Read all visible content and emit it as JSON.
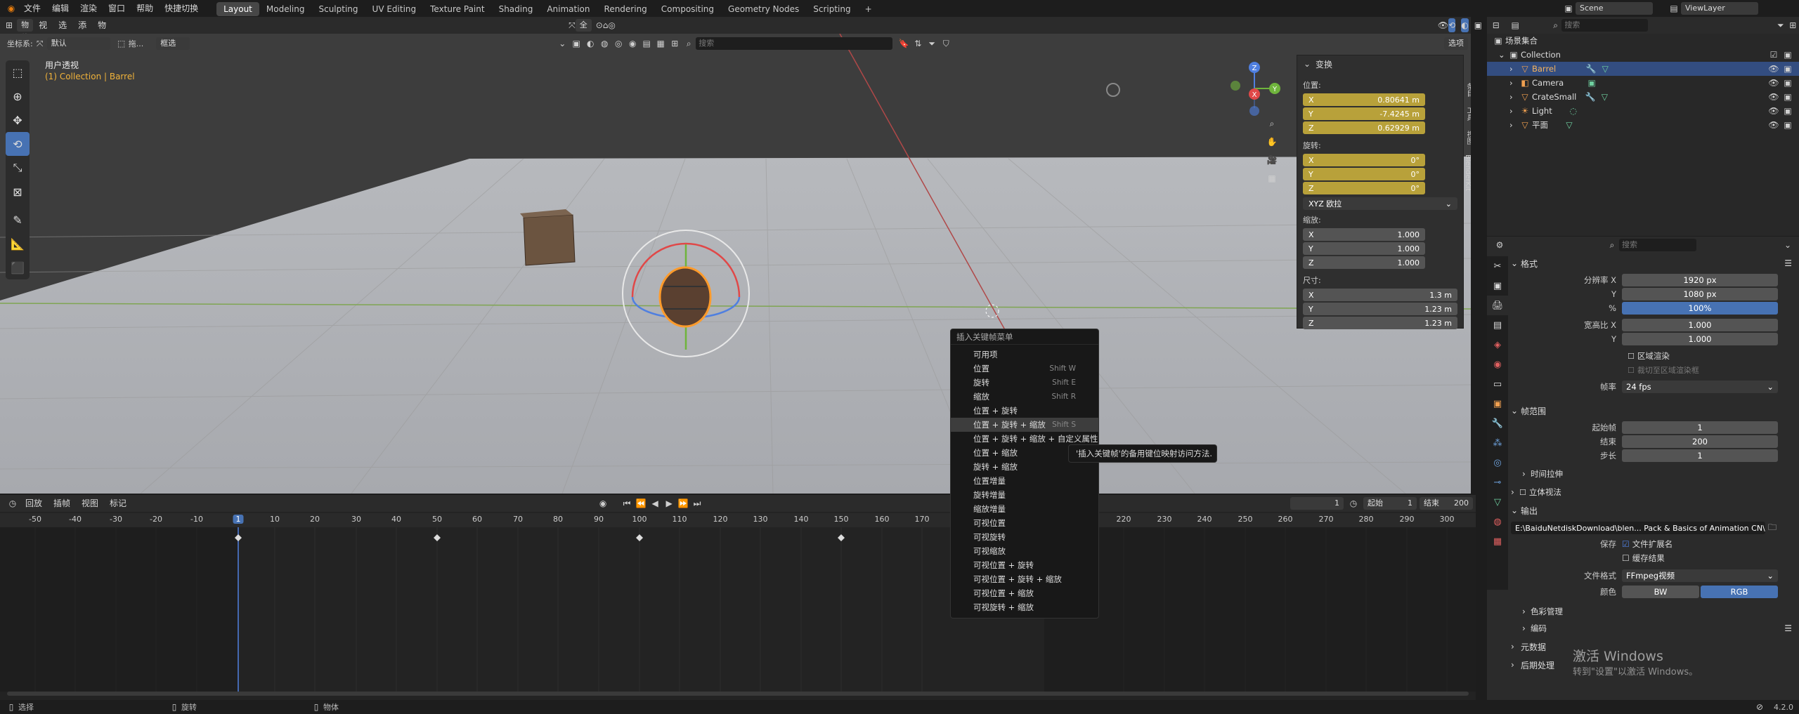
{
  "topbar": {
    "menus": [
      "文件",
      "编辑",
      "渲染",
      "窗口",
      "帮助",
      "快捷切换"
    ],
    "workspaces": [
      "Layout",
      "Modeling",
      "Sculpting",
      "UV Editing",
      "Texture Paint",
      "Shading",
      "Animation",
      "Rendering",
      "Compositing",
      "Geometry Nodes",
      "Scripting"
    ],
    "active_workspace": "Layout",
    "add_tab": "+",
    "scene": "Scene",
    "view_layer": "ViewLayer"
  },
  "viewport_header": {
    "mode": "物体模式",
    "menus": [
      "视图",
      "选择",
      "添加",
      "物体"
    ],
    "transform_orient": "全局",
    "coord_label": "坐标系:",
    "coord_value": "默认",
    "drag_label": "拖...",
    "select_mode": "框选",
    "search_placeholder": "搜索",
    "options": "选项"
  },
  "viewport": {
    "view_name": "用户透视",
    "collection_info": "(1) Collection | Barrel",
    "side_tabs": [
      "条目",
      "工具",
      "视图",
      "BlenderKit"
    ]
  },
  "transform_panel": {
    "title": "变换",
    "location_label": "位置:",
    "location": [
      {
        "axis": "X",
        "value": "0.80641 m"
      },
      {
        "axis": "Y",
        "value": "-7.4245 m"
      },
      {
        "axis": "Z",
        "value": "0.62929 m"
      }
    ],
    "rotation_label": "旋转:",
    "rotation": [
      {
        "axis": "X",
        "value": "0°"
      },
      {
        "axis": "Y",
        "value": "0°"
      },
      {
        "axis": "Z",
        "value": "0°"
      }
    ],
    "rotation_mode": "XYZ 欧拉",
    "scale_label": "缩放:",
    "scale": [
      {
        "axis": "X",
        "value": "1.000"
      },
      {
        "axis": "Y",
        "value": "1.000"
      },
      {
        "axis": "Z",
        "value": "1.000"
      }
    ],
    "dimensions_label": "尺寸:",
    "dimensions": [
      {
        "axis": "X",
        "value": "1.3 m"
      },
      {
        "axis": "Y",
        "value": "1.23 m"
      },
      {
        "axis": "Z",
        "value": "1.23 m"
      }
    ]
  },
  "context_menu": {
    "title": "插入关键帧菜单",
    "items": [
      {
        "label": "可用项",
        "shortcut": ""
      },
      {
        "label": "位置",
        "shortcut": "Shift W"
      },
      {
        "label": "旋转",
        "shortcut": "Shift E"
      },
      {
        "label": "缩放",
        "shortcut": "Shift R"
      },
      {
        "label": "位置 + 旋转",
        "shortcut": ""
      },
      {
        "label": "位置 + 旋转 + 缩放",
        "shortcut": "Shift S"
      },
      {
        "label": "位置 + 旋转 + 缩放 + 自定义属性",
        "shortcut": ""
      },
      {
        "label": "位置 + 缩放",
        "shortcut": ""
      },
      {
        "label": "旋转 + 缩放",
        "shortcut": ""
      },
      {
        "label": "位置增量",
        "shortcut": ""
      },
      {
        "label": "旋转增量",
        "shortcut": ""
      },
      {
        "label": "缩放增量",
        "shortcut": ""
      },
      {
        "label": "可视位置",
        "shortcut": ""
      },
      {
        "label": "可视旋转",
        "shortcut": ""
      },
      {
        "label": "可视缩放",
        "shortcut": ""
      },
      {
        "label": "可视位置 + 旋转",
        "shortcut": ""
      },
      {
        "label": "可视位置 + 旋转 + 缩放",
        "shortcut": ""
      },
      {
        "label": "可视位置 + 缩放",
        "shortcut": ""
      },
      {
        "label": "可视旋转 + 缩放",
        "shortcut": ""
      }
    ],
    "tooltip": "'插入关键帧'的备用键位映射访问方法."
  },
  "timeline": {
    "menus": [
      "回放",
      "插帧",
      "视图",
      "标记"
    ],
    "current_frame": "1",
    "start_label": "起始",
    "start": "1",
    "end_label": "结束",
    "end": "200",
    "ruler_left": [
      "-50",
      "-40",
      "-30",
      "-20",
      "-10",
      "1",
      "10",
      "20",
      "30",
      "40",
      "50",
      "60",
      "70",
      "80",
      "90",
      "100",
      "110",
      "120",
      "130",
      "140",
      "150",
      "160",
      "170"
    ],
    "ruler_right": [
      "220",
      "230",
      "240",
      "250",
      "260",
      "270",
      "280",
      "290",
      "300"
    ],
    "playhead": "1"
  },
  "status_bar": {
    "items": [
      "选择",
      "旋转",
      "物体"
    ],
    "version": "4.2.0"
  },
  "outliner": {
    "search_placeholder": "搜索",
    "root": "场景集合",
    "collection": "Collection",
    "objects": [
      {
        "name": "Barrel",
        "selected": true
      },
      {
        "name": "Camera",
        "selected": false
      },
      {
        "name": "CrateSmall",
        "selected": false
      },
      {
        "name": "Light",
        "selected": false
      },
      {
        "name": "平面",
        "selected": false
      }
    ]
  },
  "properties": {
    "search_placeholder": "搜索",
    "format_title": "格式",
    "res_x_label": "分辨率 X",
    "res_x": "1920 px",
    "res_y_label": "Y",
    "res_y": "1080 px",
    "pct_label": "%",
    "pct": "100%",
    "aspect_x_label": "宽高比 X",
    "aspect_x": "1.000",
    "aspect_y_label": "Y",
    "aspect_y": "1.000",
    "border_label": "区域渲染",
    "crop_label": "裁切至区域渲染框",
    "fps_label": "帧率",
    "fps": "24 fps",
    "frame_range_title": "帧范围",
    "frame_start_label": "起始帧",
    "frame_start": "1",
    "frame_end_label": "结束",
    "frame_end": "200",
    "frame_step_label": "步长",
    "frame_step": "1",
    "time_stretch": "时间拉伸",
    "stereo": "立体视法",
    "output_title": "输出",
    "output_path": "E:\\BaiduNetdiskDownload\\blen... Pack & Basics of Animation CN\\",
    "save_label": "保存",
    "file_ext": "文件扩展名",
    "cache_result": "缓存结果",
    "file_format_label": "文件格式",
    "file_format": "FFmpeg视频",
    "color_label": "颜色",
    "color_bw": "BW",
    "color_rgb": "RGB",
    "color_mgmt": "色彩管理",
    "encoding": "编码",
    "metadata": "元数据",
    "post_processing": "后期处理",
    "watermark1": "激活 Windows",
    "watermark2": "转到\"设置\"以激活 Windows。"
  }
}
